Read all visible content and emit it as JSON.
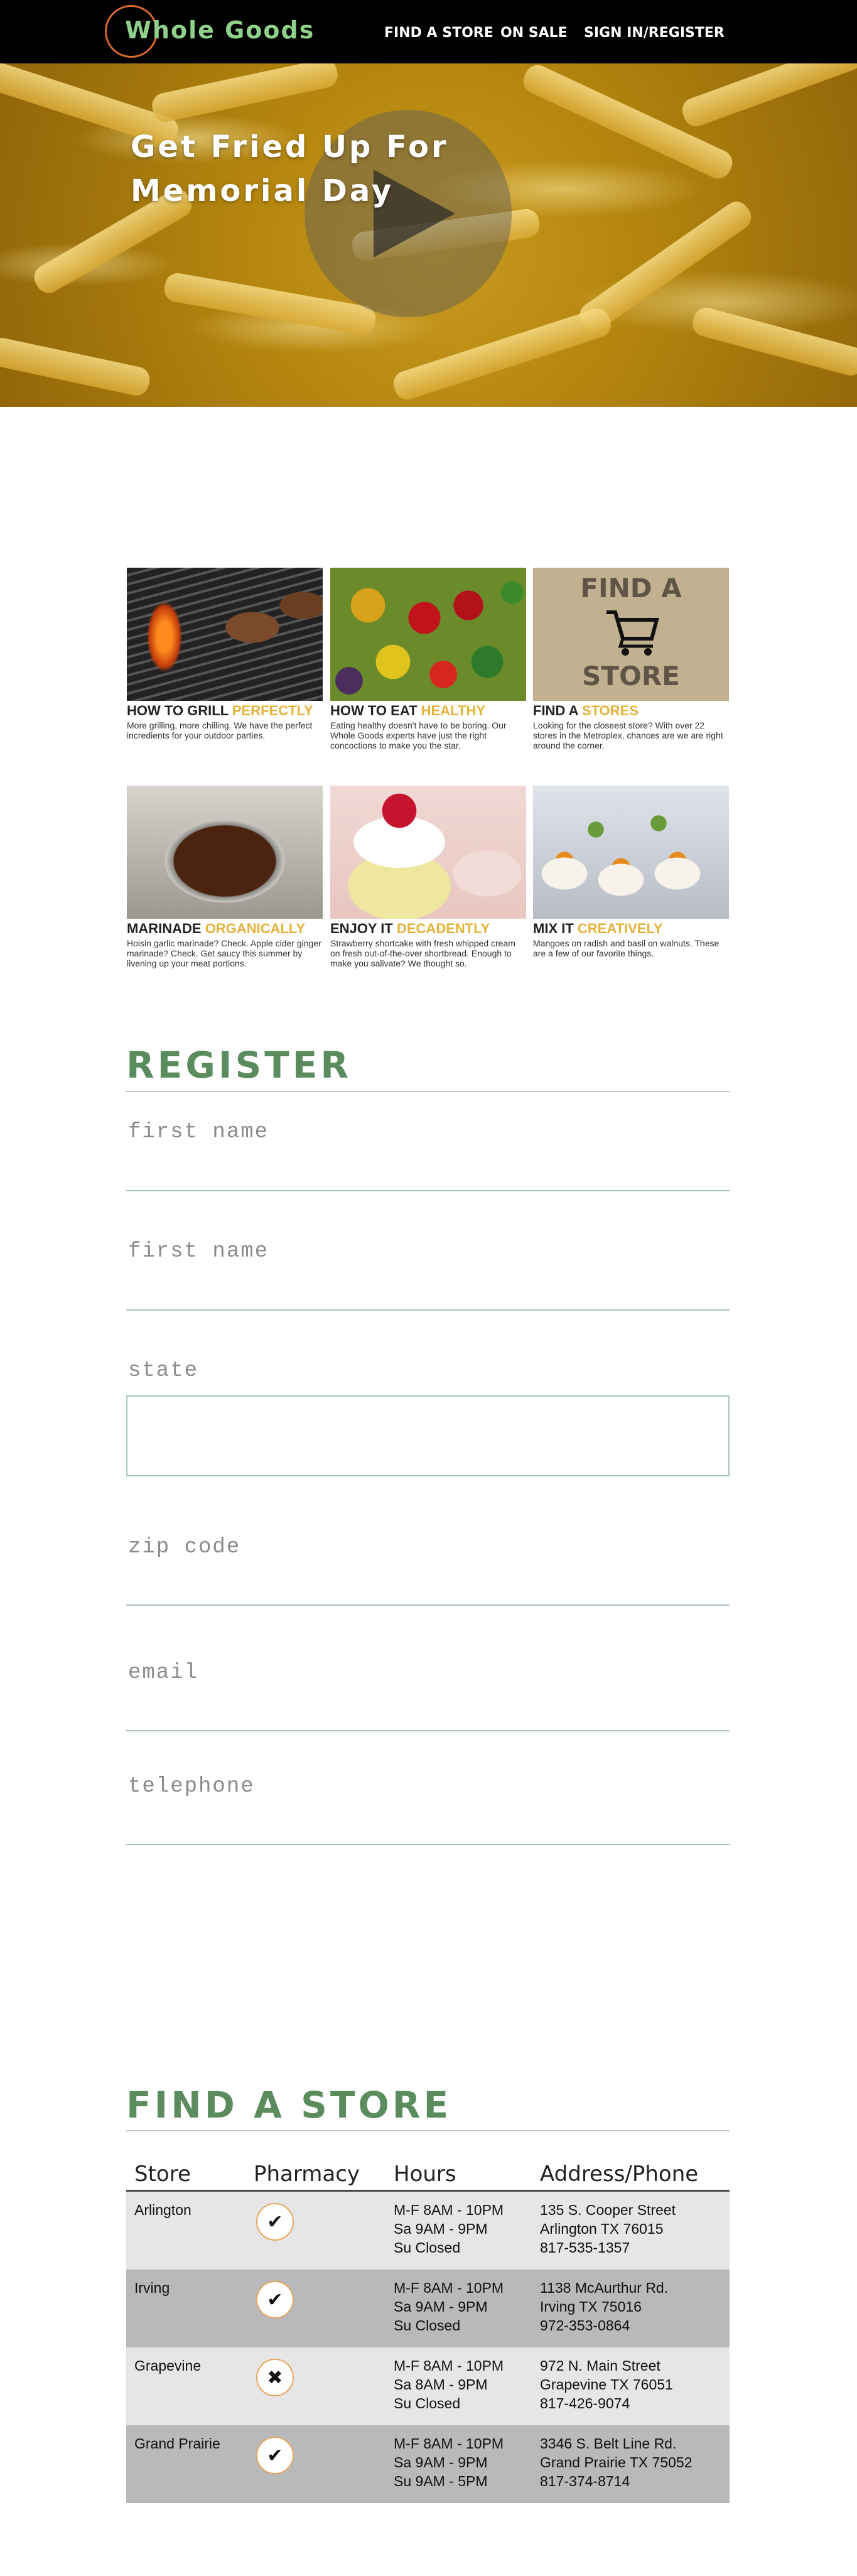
{
  "header": {
    "logo": "Whole Goods",
    "nav": [
      "FIND A STORE",
      "ON SALE",
      "SIGN IN/REGISTER"
    ]
  },
  "hero": {
    "title_line1": "Get Fried Up For",
    "title_line2": "Memorial Day",
    "play_icon": "play-icon"
  },
  "cards": [
    {
      "title": "HOW TO GRILL",
      "accent": "PERFECTLY",
      "text": "More grilling, more chilling. We have the perfect incredients for your outdoor parties."
    },
    {
      "title": "HOW TO EAT",
      "accent": "HEALTHY",
      "text": "Eating healthy doesn't have to be boring. Our Whole Goods experts have just the right concoctions to make you the star."
    },
    {
      "title": "FIND A",
      "accent": "STORES",
      "text": "Looking for the closeest store? With over 22 stores in the Metroplex, chances are we are right around the corner.",
      "image_line1": "FIND A",
      "image_line2": "STORE"
    },
    {
      "title": "MARINADE",
      "accent": "ORGANICALLY",
      "text": "Hoisin garlic marinade? Check. Apple cider ginger marinade? Check. Get saucy this summer by livening up your meat portions."
    },
    {
      "title": "ENJOY IT",
      "accent": "DECADENTLY",
      "text": "Strawberry shortcake with fresh whipped cream on fresh out-of-the-over shortbread. Enough to make you salivate? We thought so."
    },
    {
      "title": "MIX IT",
      "accent": "CREATIVELY",
      "text": "Mangoes on radish and basil on walnuts. These are a few of our favorite things."
    }
  ],
  "register": {
    "title": "REGISTER",
    "fields": [
      "first name",
      "first name",
      "state",
      "zip code",
      "email",
      "telephone"
    ]
  },
  "stores": {
    "title": "FIND A STORE",
    "headers": [
      "Store",
      "Pharmacy",
      "Hours",
      "Address/Phone"
    ],
    "rows": [
      {
        "store": "Arlington",
        "pharmacy": "✔",
        "hours": "M-F 8AM - 10PM\nSa 9AM - 9PM\nSu Closed",
        "address": "135 S. Cooper Street\nArlington TX 76015\n817-535-1357"
      },
      {
        "store": "Irving",
        "pharmacy": "✔",
        "hours": "M-F 8AM - 10PM\nSa 9AM - 9PM\nSu Closed",
        "address": "1138 McAurthur Rd.\nIrving TX 75016\n972-353-0864"
      },
      {
        "store": "Grapevine",
        "pharmacy": "✖",
        "hours": "M-F 8AM - 10PM\nSa 8AM - 9PM\nSu Closed",
        "address": "972 N. Main Street\nGrapevine TX 76051\n817-426-9074"
      },
      {
        "store": "Grand Prairie",
        "pharmacy": "✔",
        "hours": "M-F 8AM - 10PM\nSa 9AM - 9PM\nSu 9AM - 5PM",
        "address": "3346 S. Belt Line Rd.\nGrand Prairie TX 75052\n817-374-8714"
      }
    ]
  },
  "colors": {
    "header_bg": "#000000",
    "logo_green": "#8fd18a",
    "logo_ring": "#d9692c",
    "accent_gold": "#e5b23a",
    "section_green": "#5b8c5e"
  }
}
